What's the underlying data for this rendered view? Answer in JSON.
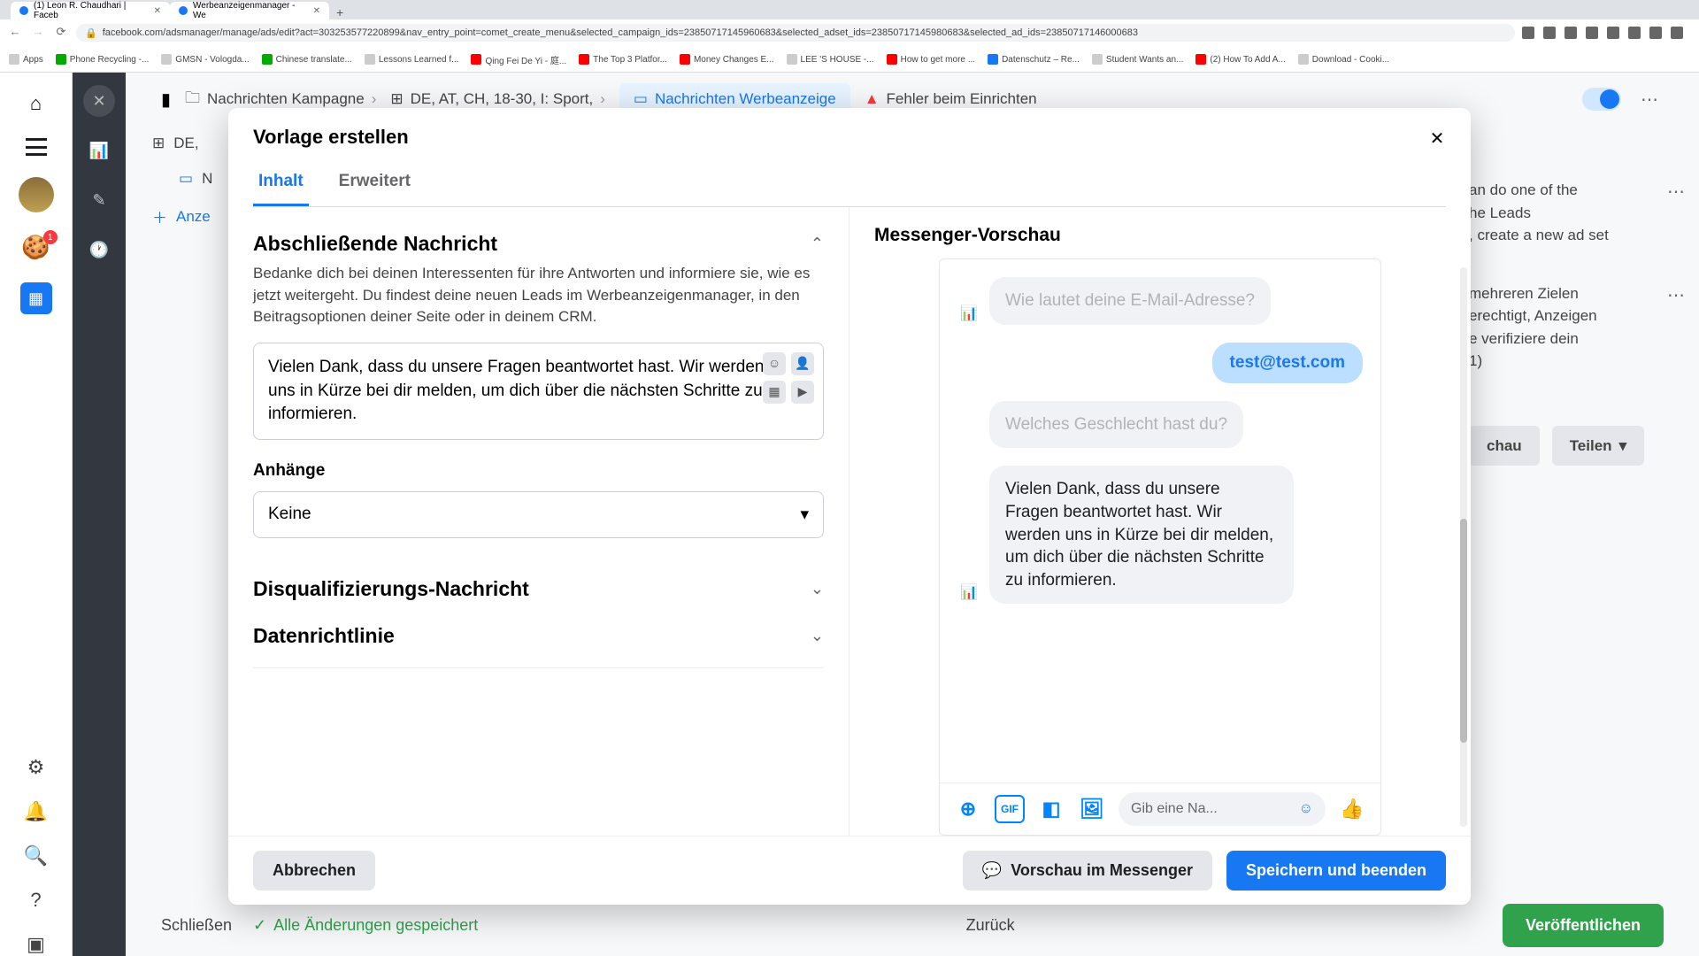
{
  "browser": {
    "tabs": [
      {
        "title": "(1) Leon R. Chaudhari | Faceb"
      },
      {
        "title": "Werbeanzeigenmanager - We"
      }
    ],
    "url": "facebook.com/adsmanager/manage/ads/edit?act=303253577220899&nav_entry_point=comet_create_menu&selected_campaign_ids=23850717145960683&selected_adset_ids=23850717145980683&selected_ad_ids=23850717146000683",
    "bookmarks": [
      "Apps",
      "Phone Recycling -...",
      "GMSN - Vologda...",
      "Chinese translate...",
      "Lessons Learned f...",
      "Qing Fei De Yi - 庭...",
      "The Top 3 Platfor...",
      "Money Changes E...",
      "LEE 'S HOUSE -...",
      "How to get more ...",
      "Datenschutz – Re...",
      "Student Wants an...",
      "(2) How To Add A...",
      "Download - Cooki..."
    ]
  },
  "rail": {
    "badge": "1"
  },
  "bg": {
    "crumbs": {
      "campaign": "Nachrichten Kampagne",
      "adset": "DE, AT, CH, 18-30, I: Sport,",
      "ad": "Nachrichten Werbeanzeige"
    },
    "left": {
      "row1": "DE,",
      "row2": "N",
      "add": "Anze"
    },
    "error": "Fehler beim Einrichten",
    "right": {
      "p1a": "an do one of the",
      "p1b": "he Leads",
      "p1c": ", create a new ad set",
      "p2a": "mehreren Zielen",
      "p2b": "erechtigt, Anzeigen",
      "p2c": "e verifiziere dein",
      "p2d": "1)",
      "preview": "chau",
      "share": "Teilen"
    },
    "footer": {
      "close": "Schließen",
      "saved": "Alle Änderungen gespeichert",
      "back": "Zurück",
      "publish": "Veröffentlichen"
    }
  },
  "modal": {
    "title": "Vorlage erstellen",
    "tabs": {
      "content": "Inhalt",
      "advanced": "Erweitert"
    },
    "section1": {
      "title": "Abschließende Nachricht",
      "desc": "Bedanke dich bei deinen Interessenten für ihre Antworten und informiere sie, wie es jetzt weitergeht. Du findest deine neuen Leads im Werbeanzeigenmanager, in den Beitragsoptionen deiner Seite oder in deinem CRM.",
      "message": "Vielen Dank, dass du unsere Fragen beantwortet hast. Wir werden uns in Kürze bei dir melden, um dich über die nächsten Schritte zu informieren.",
      "attach_label": "Anhänge",
      "attach_value": "Keine"
    },
    "section2": {
      "title": "Disqualifizierungs-Nachricht"
    },
    "section3": {
      "title": "Datenrichtlinie"
    },
    "preview": {
      "title": "Messenger-Vorschau",
      "q_email": "Wie lautet deine E-Mail-Adresse?",
      "a_email": "test@test.com",
      "q_gender": "Welches Geschlecht hast du?",
      "final_msg": "Vielen Dank, dass du unsere Fragen beantwortet hast. Wir werden uns in Kürze bei dir melden, um dich über die nächsten Schritte zu informieren.",
      "input_placeholder": "Gib eine Na..."
    },
    "footer": {
      "cancel": "Abbrechen",
      "preview_btn": "Vorschau im Messenger",
      "save": "Speichern und beenden"
    }
  }
}
